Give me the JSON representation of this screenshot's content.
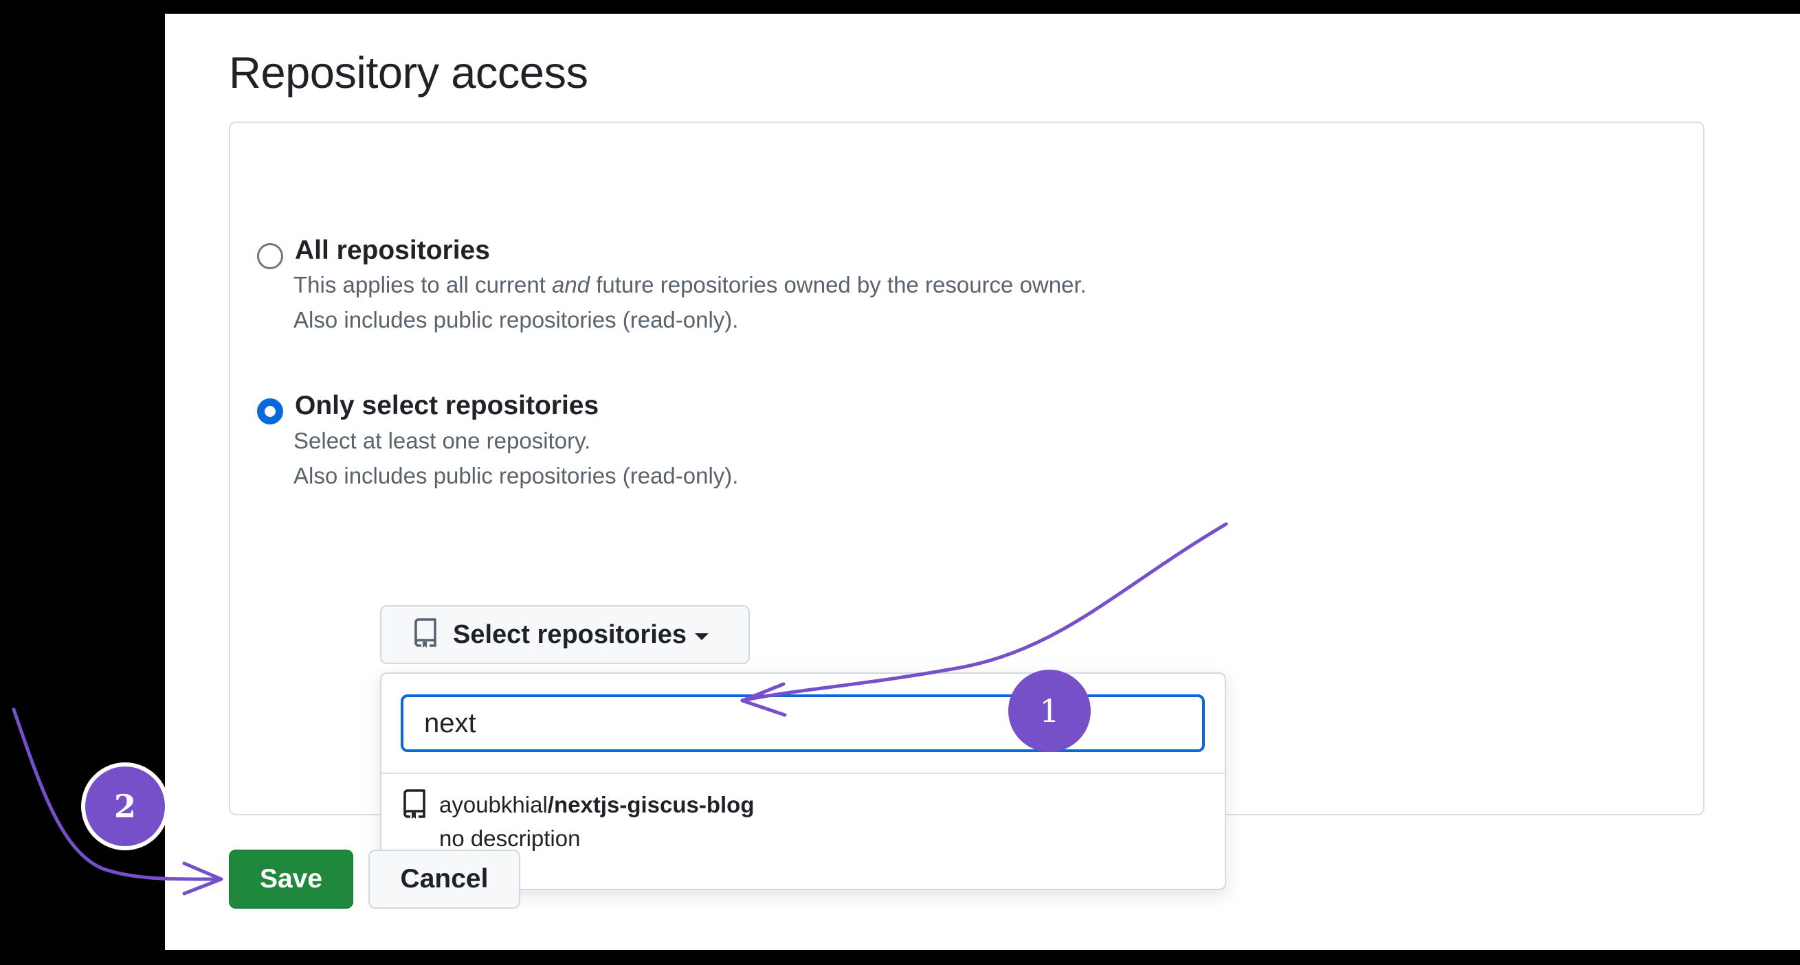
{
  "page": {
    "title": "Repository access"
  },
  "options": {
    "all": {
      "title": "All repositories",
      "desc_prefix": "This applies to all current ",
      "desc_em": "and",
      "desc_suffix": " future repositories owned by the resource owner.",
      "desc_line2": "Also includes public repositories (read-only).",
      "selected": false
    },
    "select": {
      "title": "Only select repositories",
      "desc_line1": "Select at least one repository.",
      "desc_line2": "Also includes public repositories (read-only).",
      "selected": true
    }
  },
  "select_button": {
    "label": "Select repositories",
    "icon": "repo-icon"
  },
  "dropdown": {
    "filter_value": "next",
    "results": [
      {
        "owner": "ayoubkhial",
        "repo": "/nextjs-giscus-blog",
        "description": "no description",
        "icon": "repo-icon"
      }
    ]
  },
  "actions": {
    "save_label": "Save",
    "cancel_label": "Cancel"
  },
  "annotations": {
    "badge_1": "1",
    "badge_2": "2",
    "color": "#7550c8"
  },
  "colors": {
    "accent_blue": "#0969da",
    "save_green": "#1f883d",
    "background": "#000000"
  }
}
